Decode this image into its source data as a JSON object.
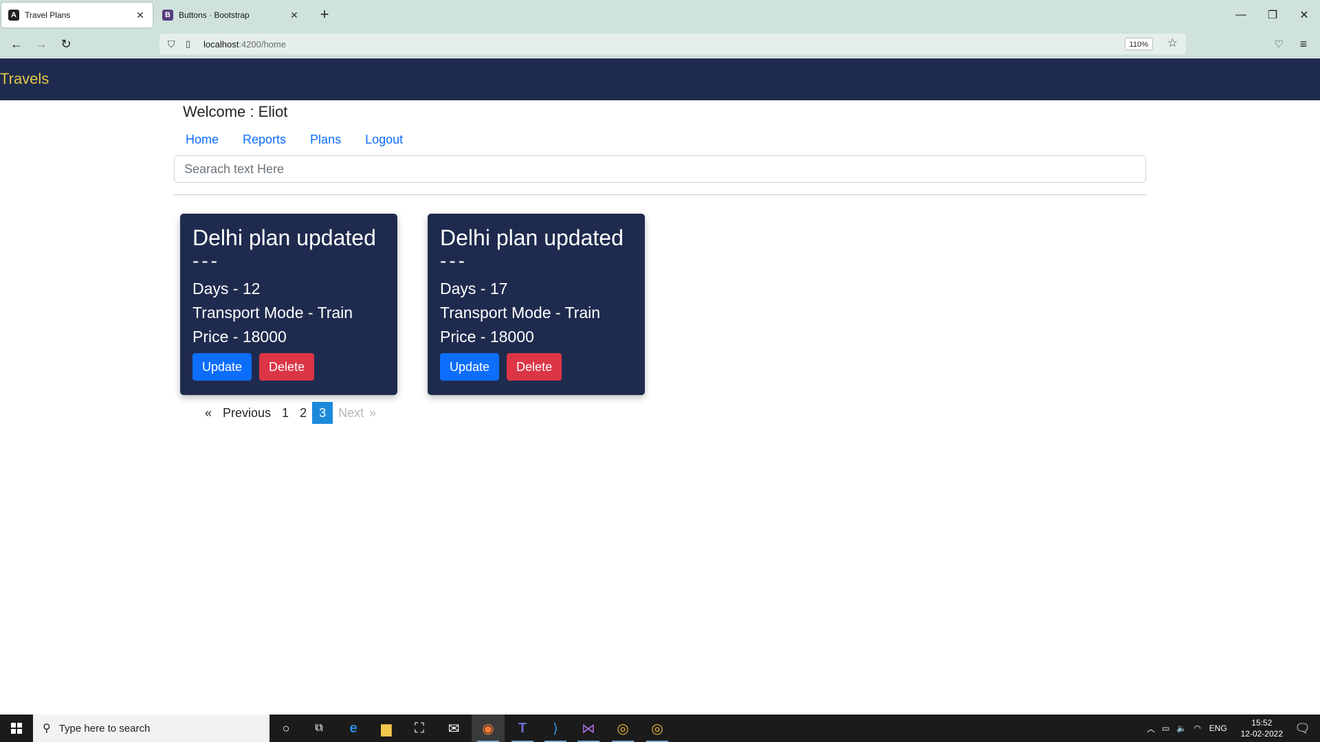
{
  "browser": {
    "tabs": [
      {
        "title": "Travel Plans",
        "icon": "angular-icon",
        "active": true
      },
      {
        "title": "Buttons · Bootstrap",
        "icon": "bootstrap-icon",
        "active": false
      }
    ],
    "url_host": "localhost",
    "url_path": ":4200/home",
    "zoom": "110%"
  },
  "app": {
    "brand": "Travels",
    "welcome": "Welcome : Eliot",
    "nav": [
      "Home",
      "Reports",
      "Plans",
      "Logout"
    ],
    "search_placeholder": "Searach text Here",
    "colors": {
      "header": "#1f2b4e",
      "brand": "#e1c744",
      "link": "#0d6efd",
      "update": "#0d6efd",
      "delete": "#dc3545",
      "active_page": "#1c8adb"
    }
  },
  "cards": [
    {
      "title": "Delhi plan updated",
      "separator": "---",
      "days": "Days - 12",
      "transport": "Transport Mode - Train",
      "price": "Price - 18000",
      "update_label": "Update",
      "delete_label": "Delete"
    },
    {
      "title": "Delhi plan updated",
      "separator": "---",
      "days": "Days - 17",
      "transport": "Transport Mode - Train",
      "price": "Price - 18000",
      "update_label": "Update",
      "delete_label": "Delete"
    }
  ],
  "pagination": {
    "prev_arrow": "«",
    "prev_label": "Previous",
    "pages": [
      "1",
      "2",
      "3"
    ],
    "current_page": "3",
    "next_label": "Next",
    "next_arrow": "»"
  },
  "taskbar": {
    "search_placeholder": "Type here to search",
    "language": "ENG",
    "time": "15:52",
    "date": "12-02-2022"
  }
}
